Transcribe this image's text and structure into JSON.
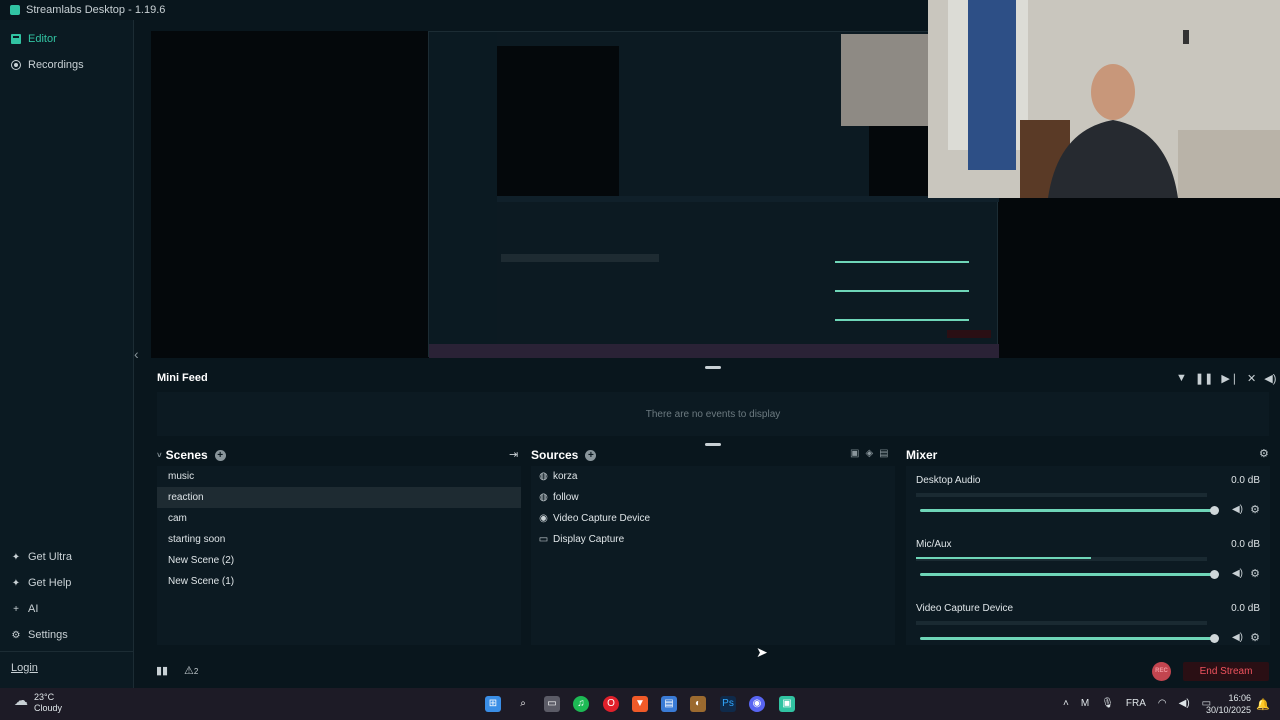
{
  "window": {
    "title": "Streamlabs Desktop - 1.19.6"
  },
  "sidebar": {
    "top_items": [
      {
        "label": "Editor",
        "icon": "editor-icon",
        "active": true
      },
      {
        "label": "Recordings",
        "icon": "recordings-icon",
        "active": false
      }
    ],
    "bottom_items": [
      {
        "label": "Get Ultra",
        "icon": "ultra-icon"
      },
      {
        "label": "Get Help",
        "icon": "help-icon"
      },
      {
        "label": "AI",
        "icon": "ai-icon"
      },
      {
        "label": "Settings",
        "icon": "gear-icon"
      }
    ],
    "login_label": "Login"
  },
  "mini_feed": {
    "title": "Mini Feed",
    "empty_message": "There are no events to display"
  },
  "scenes": {
    "title": "Scenes",
    "items": [
      "music",
      "reaction",
      "cam",
      "starting soon",
      "New Scene (2)",
      "New Scene (1)"
    ],
    "selected": "reaction"
  },
  "sources": {
    "title": "Sources",
    "items": [
      {
        "label": "korza",
        "icon": "globe-icon"
      },
      {
        "label": "follow",
        "icon": "globe-icon"
      },
      {
        "label": "Video Capture Device",
        "icon": "webcam-icon"
      },
      {
        "label": "Display Capture",
        "icon": "monitor-icon"
      }
    ]
  },
  "mixer": {
    "title": "Mixer",
    "channels": [
      {
        "name": "Desktop Audio",
        "db": "0.0 dB",
        "level": 0.0
      },
      {
        "name": "Mic/Aux",
        "db": "0.0 dB",
        "level": 0.6
      },
      {
        "name": "Video Capture Device",
        "db": "0.0 dB",
        "level": 0.0
      }
    ]
  },
  "footer": {
    "end_stream_label": "End Stream",
    "rec_label": "REC",
    "alert_count": "2"
  },
  "taskbar": {
    "weather_temp": "23°C",
    "weather_desc": "Cloudy",
    "lang": "FRA",
    "time": "16:06",
    "date": "30/10/2025"
  },
  "colors": {
    "accent": "#31c3a2",
    "end_stream": "#f0535e",
    "background": "#09161d"
  }
}
